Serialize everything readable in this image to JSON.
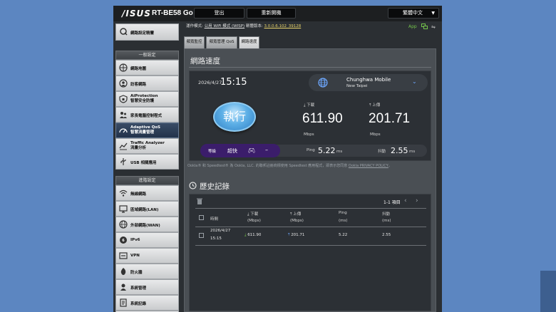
{
  "topbar": {
    "brand": "/ISUS",
    "model": "RT-BE58 Go",
    "logout": "登出",
    "reboot": "重新開機",
    "language": "繁體中文"
  },
  "status": {
    "mode_label": "運作模式:",
    "mode_value": "公用 WiFi 模式 (WISP)",
    "fw_label": "韌體版本:",
    "fw_value": "3.0.0.6.102_39128",
    "app": "App"
  },
  "sidebar": {
    "summary": "網路設定精靈",
    "general_head": "一般設定",
    "general": [
      {
        "label": "網路地圖",
        "icon": "network-map-icon"
      },
      {
        "label": "訪客網路",
        "icon": "guest-network-icon"
      },
      {
        "label1": "AiProtection",
        "label2": "智慧安全防護",
        "icon": "aiprotection-icon"
      },
      {
        "label": "家長電腦控制程式",
        "icon": "parental-control-icon"
      },
      {
        "label1": "Adaptive QoS",
        "label2": "智慧流量管理",
        "icon": "qos-icon"
      },
      {
        "label1": "Traffic Analyzer",
        "label2": "流量分析",
        "icon": "traffic-analyzer-icon"
      },
      {
        "label": "USB 相關應用",
        "icon": "usb-app-icon"
      }
    ],
    "advanced_head": "進階設定",
    "advanced": [
      {
        "label": "無線網路",
        "icon": "wireless-icon"
      },
      {
        "label": "區域網路(LAN)",
        "icon": "lan-icon"
      },
      {
        "label": "外部網路(WAN)",
        "icon": "wan-icon"
      },
      {
        "label": "IPv6",
        "icon": "ipv6-icon"
      },
      {
        "label": "VPN",
        "icon": "vpn-icon"
      },
      {
        "label": "防火牆",
        "icon": "firewall-icon"
      },
      {
        "label": "系統管理",
        "icon": "administration-icon"
      },
      {
        "label": "系統記錄",
        "icon": "system-log-icon"
      }
    ]
  },
  "tabs": [
    "頻寬監控",
    "頻寬管理 QoS",
    "網路速度"
  ],
  "speedtest": {
    "title": "網路速度",
    "date": "2026/4/27",
    "time": "15:15",
    "isp": "Chunghwa Mobile",
    "city": "New Taipei",
    "go": "執行",
    "download_label": "下載",
    "download": "611.90",
    "upload_label": "上傳",
    "upload": "201.71",
    "unit": "Mbps",
    "grade_label": "等級",
    "grade": "超快",
    "grade_extra": "–",
    "ping_label": "Ping",
    "ping": "5.22",
    "jitter_label": "抖動",
    "jitter": "2.55",
    "ms": "ms",
    "disclaimer": "Ookla® 和 Speedtest® 為 Ookla, LLC. 的聯邦註冊商標使用 Speedtest 應用程式，即表示您同意",
    "policy": "Ookla PRIVACY POLICY",
    "policy_suffix": "。"
  },
  "history": {
    "title": "歷史記錄",
    "pager": "1-1 項目",
    "headers": {
      "time": "時間",
      "down": "下載",
      "down_unit": "(Mbps)",
      "up": "上傳",
      "up_unit": "(Mbps)",
      "ping": "Ping",
      "ping_unit": "(ms)",
      "jitter": "抖動",
      "jitter_unit": "(ms)"
    },
    "rows": [
      {
        "date": "2026/4/27",
        "time": "15:15",
        "down": "611.90",
        "up": "201.71",
        "ping": "5.22",
        "jitter": "2.55"
      }
    ]
  },
  "colors": {
    "accent_green": "#74c34b",
    "accent_blue": "#6ea8ff",
    "grade_purple": "#3b1d6b",
    "firmware_yellow": "#e9d46a"
  }
}
